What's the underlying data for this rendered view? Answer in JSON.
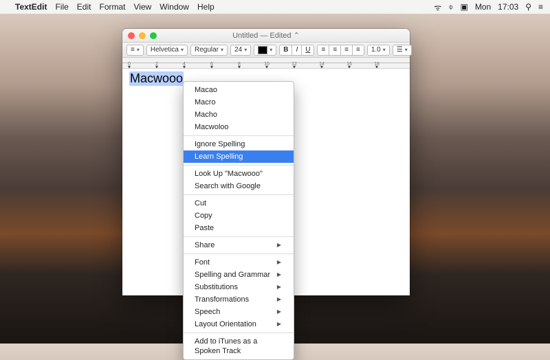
{
  "menubar": {
    "apple_glyph": "",
    "app_name": "TextEdit",
    "items": [
      "File",
      "Edit",
      "Format",
      "View",
      "Window",
      "Help"
    ],
    "status": {
      "wifi_glyph": "⌔",
      "battery": "▣",
      "weekday": "Mon",
      "time": "17:03",
      "search_glyph": "🔍",
      "notif_glyph": "≡"
    }
  },
  "window": {
    "title": "Untitled — Edited ⌃",
    "toolbar": {
      "show_text": "≡",
      "font_family": "Helvetica",
      "font_style": "Regular",
      "font_size": "24",
      "bold": "B",
      "italic": "I",
      "underline": "U",
      "spacing": "1.0"
    },
    "ruler_labels": [
      "0",
      "2",
      "4",
      "6",
      "8",
      "10",
      "12",
      "14",
      "16",
      "18"
    ],
    "selected_text": "Macwooo"
  },
  "context_menu": {
    "suggestions": [
      "Macao",
      "Macro",
      "Macho",
      "Macwoloo"
    ],
    "ignore": "Ignore Spelling",
    "learn": "Learn Spelling",
    "lookup": "Look Up \"Macwooo\"",
    "search_google": "Search with Google",
    "cut": "Cut",
    "copy": "Copy",
    "paste": "Paste",
    "share": "Share",
    "font": "Font",
    "spelling_grammar": "Spelling and Grammar",
    "substitutions": "Substitutions",
    "transformations": "Transformations",
    "speech": "Speech",
    "layout_orientation": "Layout Orientation",
    "add_to_itunes": "Add to iTunes as a Spoken Track"
  }
}
